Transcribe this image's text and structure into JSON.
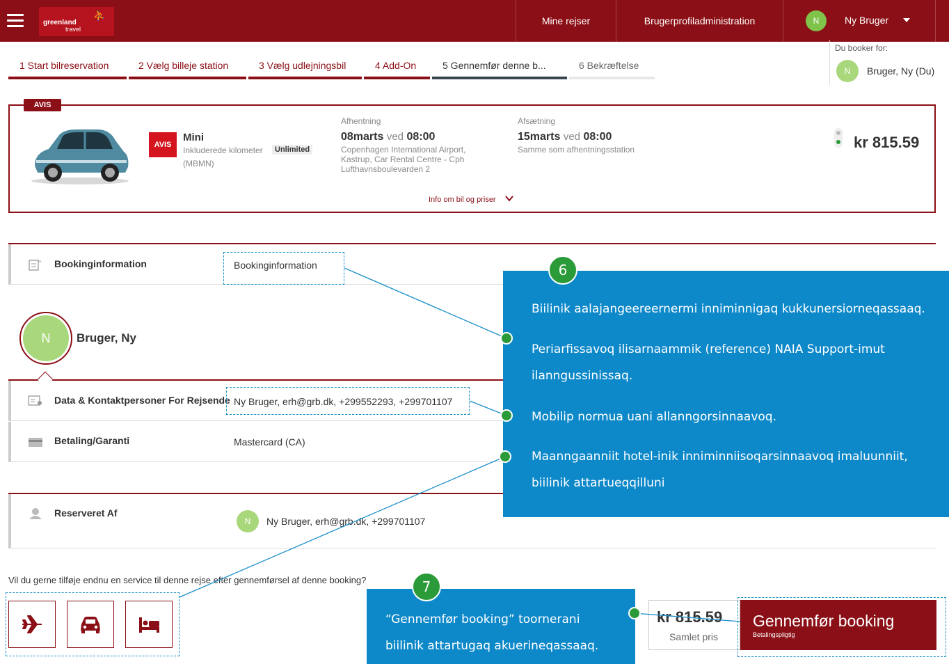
{
  "topbar": {
    "logo_line1": "greenland",
    "logo_line2": "travel",
    "nav_trips": "Mine rejser",
    "nav_profile_admin": "Brugerprofiladministration",
    "user_initial": "N",
    "user_name": "Ny Bruger"
  },
  "steps": [
    {
      "label": "1  Start bilreservation",
      "state": "done"
    },
    {
      "label": "2  Vælg billeje station",
      "state": "done"
    },
    {
      "label": "3  Vælg udlejningsbil",
      "state": "done"
    },
    {
      "label": "4  Add-On",
      "state": "done"
    },
    {
      "label": "5  Gennemfør denne b...",
      "state": "active"
    },
    {
      "label": "6  Bekræftelse",
      "state": "future"
    }
  ],
  "booking_for": {
    "label": "Du booker for:",
    "initial": "N",
    "name": "Bruger, Ny (Du)"
  },
  "car": {
    "vendor_tag": "AVIS",
    "vendor_logo": "AVIS",
    "name": "Mini",
    "km_label": "Inkluderede kilometer",
    "km_value": "Unlimited",
    "code": "(MBMN)",
    "pickup_label": "Afhentning",
    "pickup_date": "08marts",
    "pickup_ved": "ved",
    "pickup_time": "08:00",
    "pickup_addr1": "Copenhagen International Airport,",
    "pickup_addr2": "Kastrup, Car Rental Centre - Cph",
    "pickup_addr3": "Lufthavnsboulevarden 2",
    "dropoff_label": "Afsætning",
    "dropoff_date": "15marts",
    "dropoff_ved": "ved",
    "dropoff_time": "08:00",
    "dropoff_addr": "Samme som afhentningsstation",
    "price": "kr 815.59",
    "info_link": "Info om bil og priser"
  },
  "sections": {
    "booking_info": {
      "label": "Bookinginformation",
      "value": "Bookinginformation"
    },
    "traveler": {
      "initial": "N",
      "name": "Bruger, Ny"
    },
    "contact": {
      "label": "Data & Kontaktpersoner For Rejsende",
      "value": "Ny Bruger, erh@grb.dk, +299552293, +299701107"
    },
    "payment": {
      "label": "Betaling/Garanti",
      "value": "Mastercard (CA)"
    },
    "reserved_by": {
      "label": "Reserveret Af",
      "initial": "N",
      "value": "Ny Bruger, erh@grb.dk, +299701107"
    }
  },
  "addon": {
    "question": "Vil du gerne tilføje endnu en service til denne rejse efter gennemførsel af denne booking?"
  },
  "summary": {
    "total_price": "kr 815.59",
    "total_label": "Samlet pris",
    "confirm_label": "Gennemfør booking",
    "confirm_sub": "Betalingspligtig"
  },
  "callout6": {
    "number": "6",
    "line1": "Biilinik aalajangeereernermi inniminnigaq kukkunersiorneqassaaq.",
    "line2": "Periarfissavoq ilisarnaammik (reference) NAIA Support-imut",
    "line3": "ilanngussinissaq.",
    "line4": "Mobilip normua uani allanngorsinnaavoq.",
    "line5": "Maanngaanniit hotel-inik inniminniisoqarsinnaavoq imaluunniit,",
    "line6": "biilinik attartueqqilluni"
  },
  "callout7": {
    "number": "7",
    "line1": "“Gennemfør booking” toornerani",
    "line2": "biilinik attartugaq akuerineqassaaq."
  },
  "colors": {
    "brand": "#8b0f16",
    "callout": "#0d88c9",
    "badge": "#2a9b38",
    "avatar": "#a9d77c"
  },
  "icons": [
    "menu-icon",
    "caret-down-icon",
    "chevron-down-icon",
    "booking-info-icon",
    "contact-card-icon",
    "credit-card-icon",
    "support-agent-icon",
    "plane-icon",
    "car-icon",
    "hotel-bed-icon"
  ]
}
